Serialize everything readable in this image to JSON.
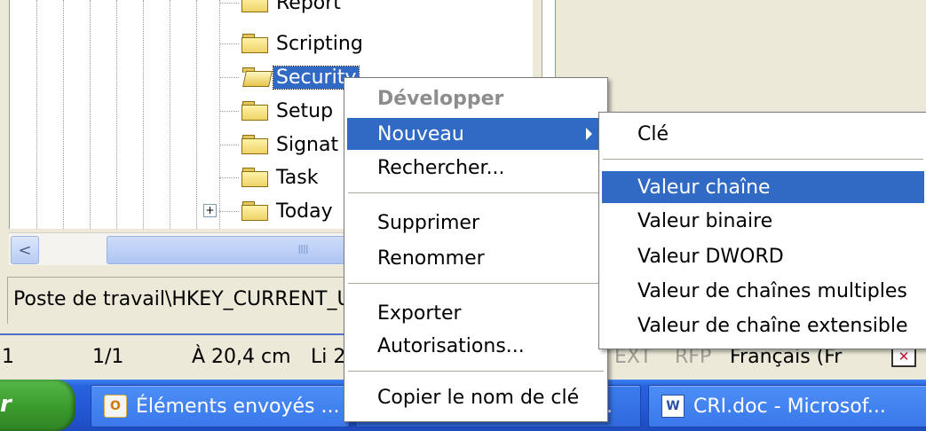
{
  "tree": {
    "nodes": [
      {
        "label": "Report"
      },
      {
        "label": "Scripting"
      },
      {
        "label": "Security"
      },
      {
        "label": "Setup"
      },
      {
        "label": "Signat"
      },
      {
        "label": "Task"
      },
      {
        "label": "Today"
      }
    ]
  },
  "scrollbar": {
    "left_arrow": "<",
    "thumb_grip": "IIII"
  },
  "statusbar": {
    "path": "Poste de travail\\HKEY_CURRENT_U"
  },
  "context_menu": {
    "items": [
      {
        "label": "Développer"
      },
      {
        "label": "Nouveau"
      },
      {
        "label": "Rechercher..."
      },
      {
        "label": "Supprimer"
      },
      {
        "label": "Renommer"
      },
      {
        "label": "Exporter"
      },
      {
        "label": "Autorisations..."
      },
      {
        "label": "Copier le nom de clé"
      }
    ]
  },
  "submenu": {
    "items": [
      {
        "label": "Clé"
      },
      {
        "label": "Valeur chaîne"
      },
      {
        "label": "Valeur binaire"
      },
      {
        "label": "Valeur DWORD"
      },
      {
        "label": "Valeur de chaînes multiples"
      },
      {
        "label": "Valeur de chaîne extensible"
      }
    ]
  },
  "word_status": {
    "section": "1",
    "page": "1/1",
    "position": "À 20,4 cm",
    "line": "Li 2",
    "ext": "EXT",
    "rfp": "RFP",
    "language": "Français (Fr"
  },
  "taskbar": {
    "start_label": "r",
    "tasks": [
      {
        "label": "Éléments envoyés ...",
        "icon": "outlook-icon"
      },
      {
        "label": "."
      },
      {
        "label": "CRI.doc - Microsof...",
        "icon": "word-icon"
      }
    ]
  },
  "colors": {
    "selection": "#316ac5",
    "taskbar": "#2457d3",
    "start": "#3a9a2c"
  }
}
